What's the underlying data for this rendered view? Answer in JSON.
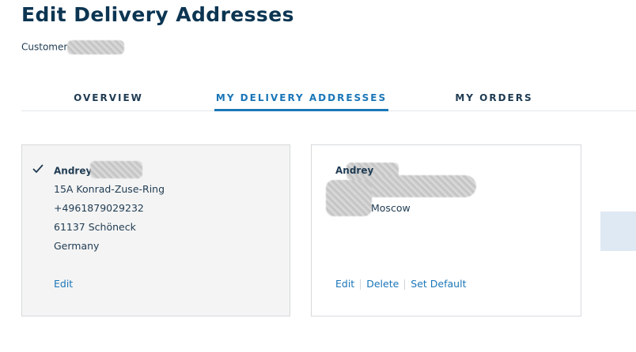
{
  "page": {
    "title": "Edit Delivery Addresses",
    "customer_label": "Customer"
  },
  "tabs": [
    {
      "label": "OVERVIEW",
      "active": false
    },
    {
      "label": "MY DELIVERY ADDRESSES",
      "active": true
    },
    {
      "label": "MY ORDERS",
      "active": false
    }
  ],
  "addresses": [
    {
      "default": true,
      "name": "Andrey",
      "street": "15A Konrad-Zuse-Ring",
      "phone": "+4961879029232",
      "city": "61137 Schöneck",
      "country": "Germany",
      "actions": {
        "edit": "Edit"
      }
    },
    {
      "default": false,
      "name": "Andrey",
      "city": "Moscow",
      "actions": {
        "edit": "Edit",
        "delete": "Delete",
        "set_default": "Set Default"
      }
    }
  ],
  "colors": {
    "title": "#0c3552",
    "accent": "#1a76b8",
    "card_default_bg": "#f4f4f4",
    "side_panel": "#dfe9f3"
  },
  "icons": {
    "default_marker": "checkmark-icon"
  }
}
